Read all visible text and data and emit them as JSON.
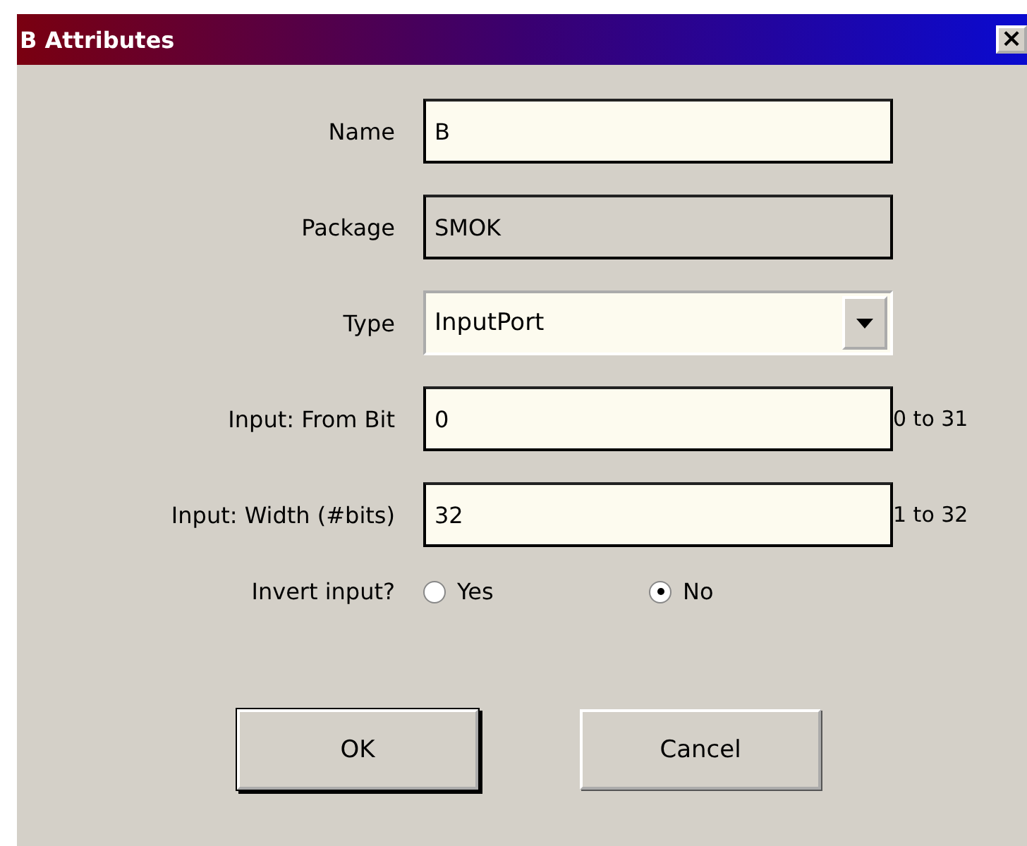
{
  "window": {
    "title": "B Attributes",
    "close": "×"
  },
  "fields": [
    {
      "label": "Name",
      "kind": "text",
      "value": "B"
    },
    {
      "label": "Package",
      "kind": "readonly",
      "value": "SMOK"
    },
    {
      "label": "Type",
      "kind": "select",
      "value": "InputPort"
    },
    {
      "label": "Input: From Bit",
      "kind": "text",
      "value": "0",
      "range": "0 to 31"
    },
    {
      "label": "Input: Width (#bits)",
      "kind": "text",
      "value": "32",
      "range": "1 to 32"
    }
  ],
  "invert": {
    "label": "Invert input?",
    "options": [
      {
        "label": "Yes",
        "selected": false
      },
      {
        "label": "No",
        "selected": true
      }
    ]
  },
  "buttons": [
    {
      "label": "OK",
      "default": true
    },
    {
      "label": "Cancel",
      "default": false
    }
  ]
}
